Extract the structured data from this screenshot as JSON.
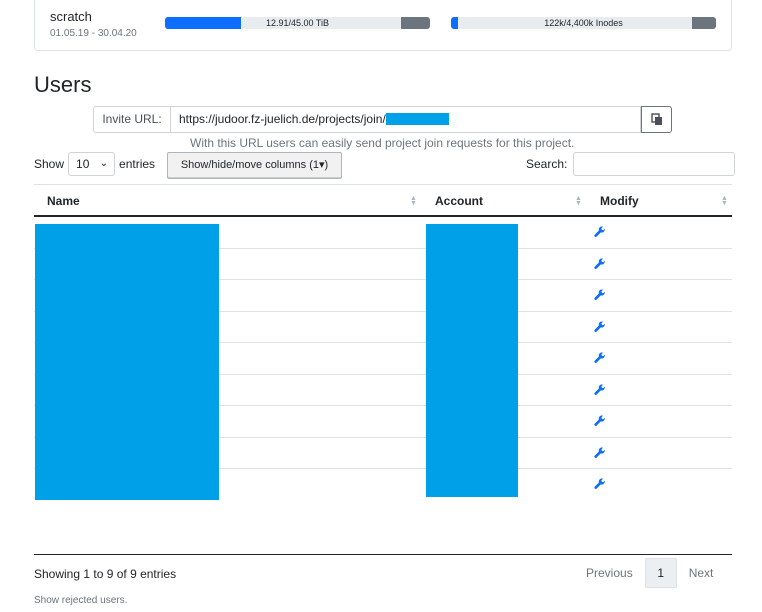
{
  "storage": {
    "name": "scratch",
    "dates": "01.05.19 - 30.04.20",
    "space_text": "12.91/45.00 TiB",
    "space_fraction": 0.287,
    "inode_text": "122k/4,400k Inodes",
    "inode_fraction": 0.028
  },
  "section_title": "Users",
  "invite": {
    "label": "Invite URL:",
    "url": "https://judoor.fz-juelich.de/projects/join/",
    "hint": "With this URL users can easily send project join requests for this project."
  },
  "controls": {
    "show_label": "Show",
    "page_length": "10",
    "entries_label": "entries",
    "columns_button": "Show/hide/move columns (1",
    "search_label": "Search:"
  },
  "table": {
    "headers": [
      "Name",
      "Account",
      "Modify"
    ],
    "rows": 9
  },
  "footer": {
    "info": "Showing 1 to 9 of 9 entries",
    "previous": "Previous",
    "page": "1",
    "next": "Next",
    "rejected": "Show rejected users."
  },
  "colors": {
    "accent": "#0d6efd",
    "redaction": "#00a0e9"
  },
  "icons": {
    "copy": "copy-icon",
    "modify": "wrench-icon",
    "sort": "sort-icon"
  }
}
